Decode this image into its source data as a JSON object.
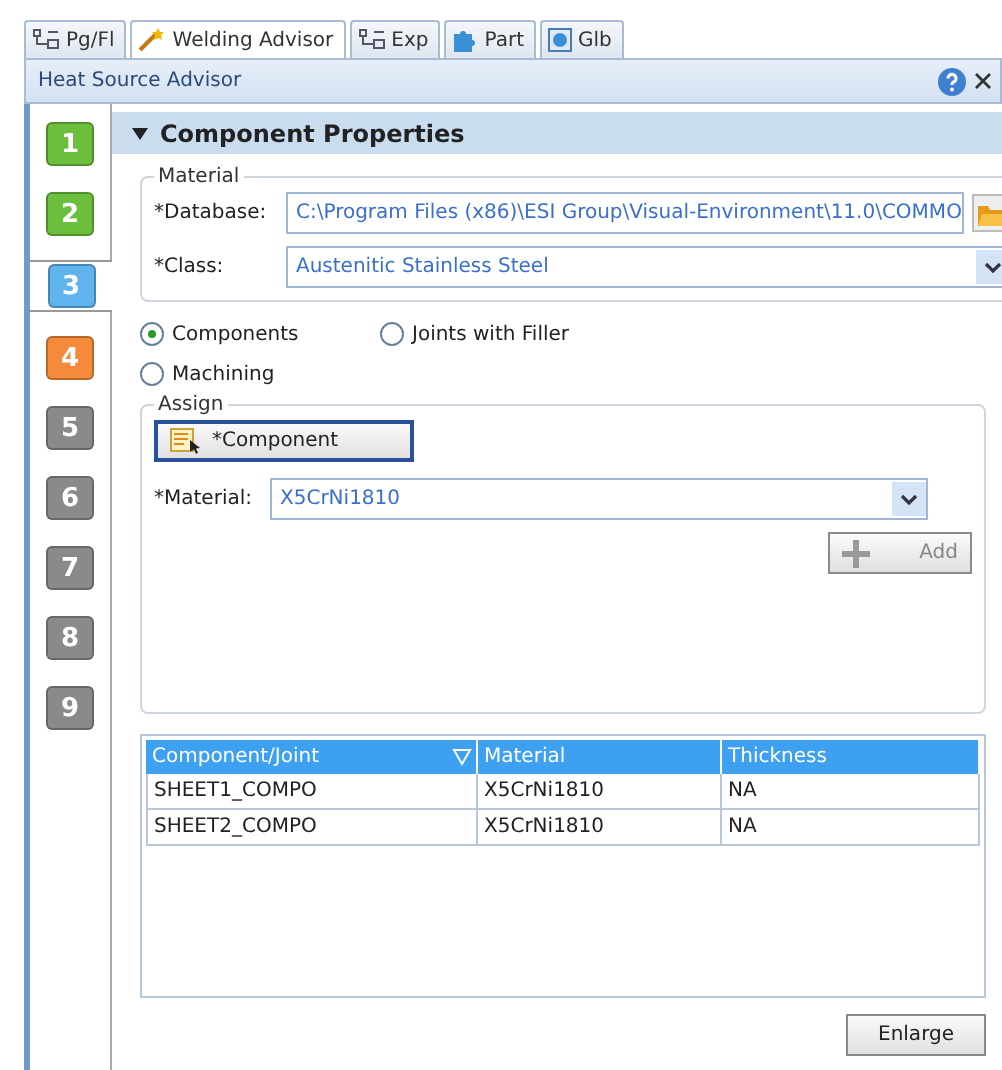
{
  "tabs": [
    {
      "label": "Pg/Fl",
      "kind": "tree",
      "selected": false
    },
    {
      "label": "Welding Advisor",
      "kind": "wand",
      "selected": true
    },
    {
      "label": "Exp",
      "kind": "tree",
      "selected": false
    },
    {
      "label": "Part",
      "kind": "puzzle",
      "selected": false
    },
    {
      "label": "Glb",
      "kind": "globe",
      "selected": false
    }
  ],
  "panel": {
    "title": "Heat Source Advisor"
  },
  "steps": [
    {
      "label": "1",
      "color": "#6cbf3c",
      "selected": false
    },
    {
      "label": "2",
      "color": "#6cbf3c",
      "selected": false
    },
    {
      "label": "3",
      "color": "#5fb4f0",
      "selected": true
    },
    {
      "label": "4",
      "color": "#f58a3a",
      "selected": false
    },
    {
      "label": "5",
      "color": "#8a8a8a",
      "selected": false
    },
    {
      "label": "6",
      "color": "#8a8a8a",
      "selected": false
    },
    {
      "label": "7",
      "color": "#8a8a8a",
      "selected": false
    },
    {
      "label": "8",
      "color": "#8a8a8a",
      "selected": false
    },
    {
      "label": "9",
      "color": "#8a8a8a",
      "selected": false
    }
  ],
  "section": {
    "title": "Component Properties",
    "expanded": true
  },
  "material_group": {
    "title": "Material",
    "database_label": "*Database:",
    "database_value": "C:\\Program Files (x86)\\ESI Group\\Visual-Environment\\11.0\\COMMO",
    "class_label": "*Class:",
    "class_value": "Austenitic Stainless Steel"
  },
  "radios": [
    {
      "label": "Components",
      "selected": true
    },
    {
      "label": "Joints with Filler",
      "selected": false
    },
    {
      "label": "Machining",
      "selected": false
    }
  ],
  "assign_group": {
    "title": "Assign",
    "component_button": "*Component",
    "material_label": "*Material:",
    "material_value": "X5CrNi1810",
    "add_button": {
      "label": "Add",
      "disabled": true
    }
  },
  "table": {
    "columns": [
      "Component/Joint",
      "Material",
      "Thickness"
    ],
    "rows": [
      [
        "SHEET1_COMPO",
        "X5CrNi1810",
        "NA"
      ],
      [
        "SHEET2_COMPO",
        "X5CrNi1810",
        "NA"
      ]
    ]
  },
  "enlarge_button": "Enlarge"
}
